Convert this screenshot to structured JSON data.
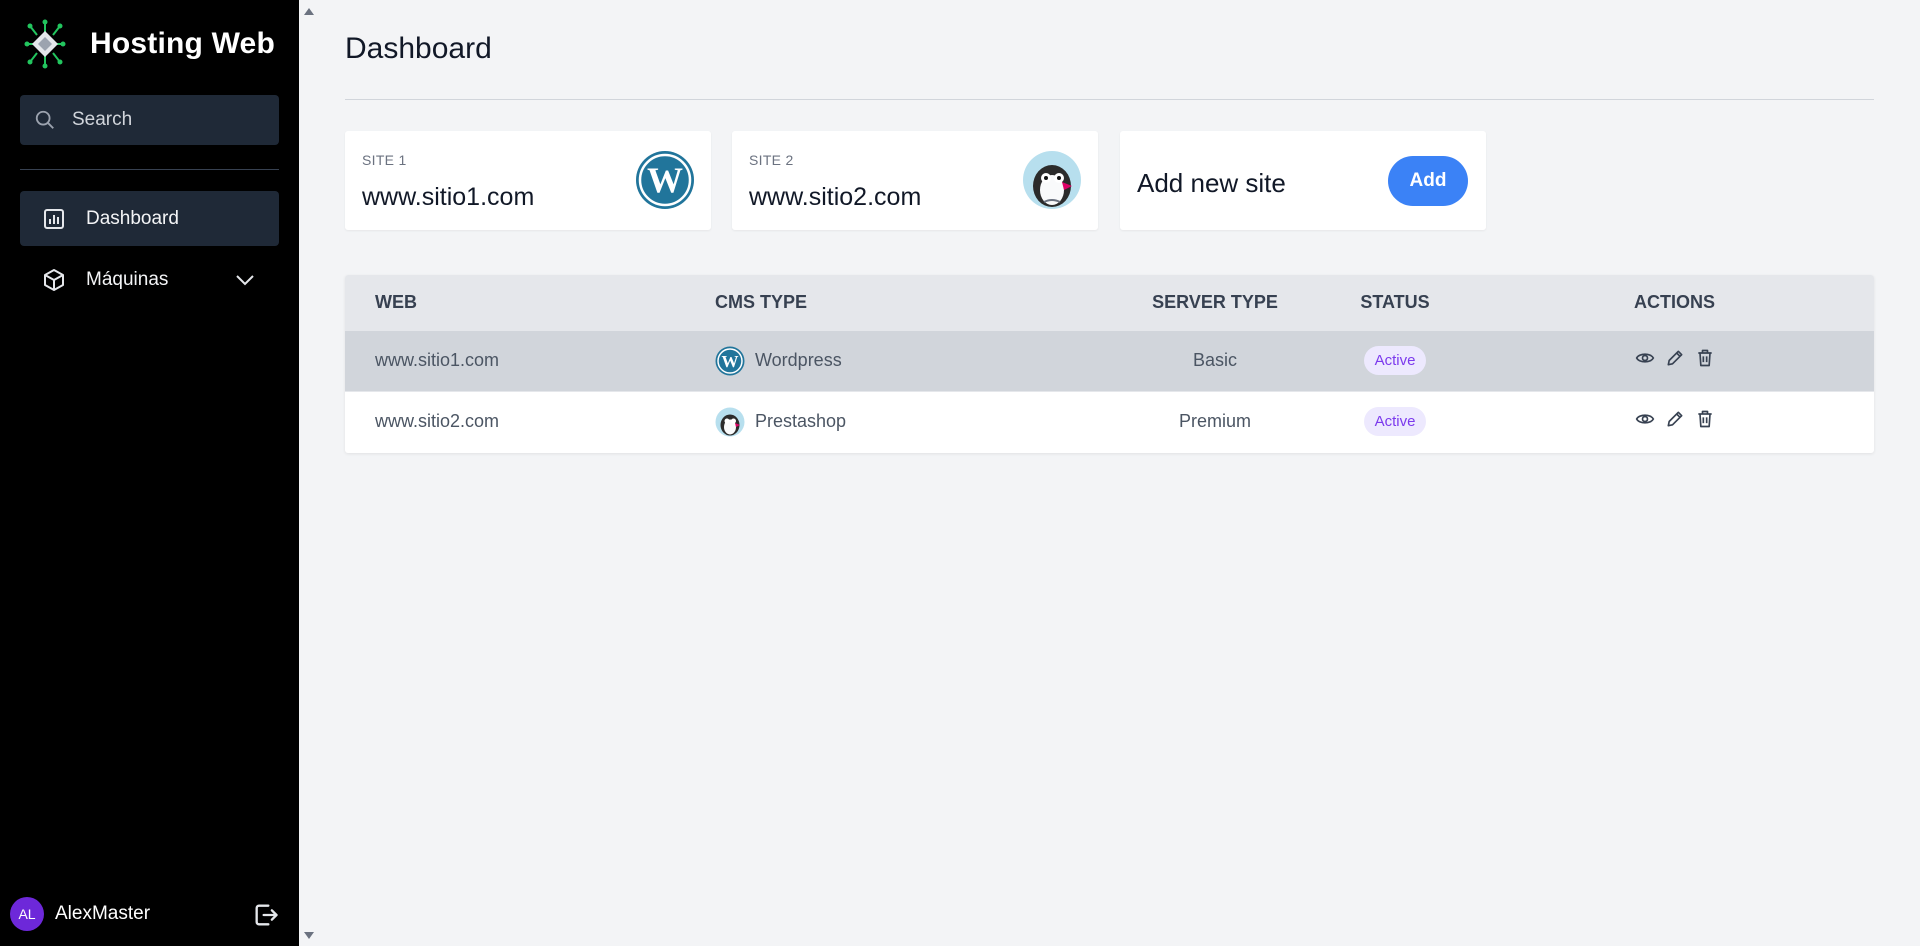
{
  "brand": {
    "title": "Hosting Web",
    "icon": "circuit-chip-logo"
  },
  "search": {
    "placeholder": "Search",
    "value": ""
  },
  "nav": [
    {
      "label": "Dashboard",
      "icon": "chart-icon",
      "active": true
    },
    {
      "label": "Máquinas",
      "icon": "cube-icon",
      "expandable": true
    }
  ],
  "user": {
    "initials": "AL",
    "name": "AlexMaster",
    "avatar_color": "#6d28d9"
  },
  "page": {
    "title": "Dashboard"
  },
  "cards": [
    {
      "label": "SITE 1",
      "domain": "www.sitio1.com",
      "logo": "wordpress-logo"
    },
    {
      "label": "SITE 2",
      "domain": "www.sitio2.com",
      "logo": "prestashop-logo"
    }
  ],
  "add_card": {
    "title": "Add new site",
    "button": "Add",
    "button_color": "#3b82f6"
  },
  "table": {
    "headers": [
      "WEB",
      "CMS TYPE",
      "SERVER TYPE",
      "STATUS",
      "ACTIONS"
    ],
    "rows": [
      {
        "web": "www.sitio1.com",
        "cms": "Wordpress",
        "cms_icon": "wordpress-icon",
        "server": "Basic",
        "status": "Active"
      },
      {
        "web": "www.sitio2.com",
        "cms": "Prestashop",
        "cms_icon": "prestashop-icon",
        "server": "Premium",
        "status": "Active"
      }
    ]
  },
  "colors": {
    "sidebar_bg": "#000000",
    "accent": "#3b82f6",
    "badge_text": "#7c3aed",
    "badge_bg": "#ede9fe"
  }
}
